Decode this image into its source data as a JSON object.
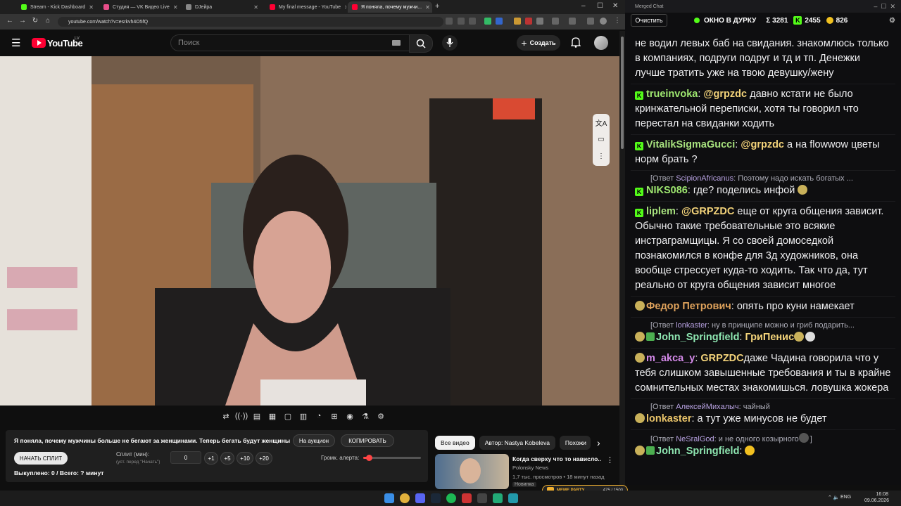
{
  "browser": {
    "tabs": [
      {
        "title": "Stream - Kick Dashboard",
        "color": "#53fc18"
      },
      {
        "title": "Студия — VK Видео Live",
        "color": "#e84e8a"
      },
      {
        "title": "DJейра",
        "color": "#888888"
      },
      {
        "title": "My final message - YouTube",
        "color": "#ff0033"
      },
      {
        "title": "Я поняла, почему мужчи...",
        "color": "#ff0033"
      }
    ],
    "url": "youtube.com/watch?v=esrkvh4O5fQ"
  },
  "youtube": {
    "brand": "YouTube",
    "region": "LV",
    "search_placeholder": "Поиск",
    "create_label": "Создать"
  },
  "panel": {
    "title": "Я поняла, почему мужчины больше не бегают за женщинами. Теперь бегать будут женщины",
    "auction_label": "На аукцион",
    "copy_label": "КОПИРОВАТЬ",
    "start_split_label": "НАЧАТЬ СПЛИТ",
    "split_label": "Сплит (мин):",
    "split_hint": "(уст. перед \"Начать\")",
    "split_value": "0",
    "plus_buttons": [
      "+1",
      "+5",
      "+10",
      "+20"
    ],
    "volume_label": "Громк. алерта:",
    "volume_level": 0.1,
    "bought_label": "Выкуплено: 0 / Всего: ? минут"
  },
  "recommend": {
    "chips": [
      "Все видео",
      "Автор: Nastya Kobeleva",
      "Похожи"
    ],
    "video": {
      "title": "Когда сверху что то нависло...",
      "channel": "Polonsky News",
      "meta": "1,7 тыс. просмотров • 18 минут назад",
      "badge": "Новинка"
    }
  },
  "chat": {
    "window_title": "Merged Chat",
    "clear_label": "Очистить",
    "top_label": "ОКНО В ДУРКУ",
    "sigma": "Σ 3281",
    "kick_count": "2455",
    "third_count": "826",
    "messages": [
      {
        "text": "не водил левых баб на свидания. знакомлюсь только в компаниях, подруги подруг и тд и тп. Денежки лучше тратить уже на твою девушку/жену"
      },
      {
        "user": "trueinvoka",
        "mention": "@grpzdc",
        "text": "давно кстати не было кринжательной переписки, хотя ты говорил что перестал на свиданки ходить"
      },
      {
        "user": "VitalikSigmaGucci",
        "mention": "@grpzdc",
        "text": "а на flowwow цветы норм брать ?"
      },
      {
        "reply_user": "ScipionAfricanus",
        "reply_text": "Поэтому надо искать богатых ...",
        "user": "NIKS086",
        "text": "где? поделись инфой"
      },
      {
        "user": "liplem",
        "mention": "@GRPZDC",
        "text": "еще от круга общения зависит. Обычно такие требовательные это всякие инстраграмщицы. Я со своей домоседкой познакомился в конфе для 3д художников, она вообще стрессует куда-то ходить. Так что да, тут реально от круга общения зависит многое"
      },
      {
        "user": "Федор Петрович",
        "text": "опять про куни намекает"
      },
      {
        "reply_user": "lonkaster",
        "reply_text": "ну в принципе можно и гриб подарить...",
        "user": "John_Springfield",
        "text": "ГриПенис"
      },
      {
        "user": "m_akca_y",
        "mention": "GRPZDC",
        "text": "даже Чадина говорила что у тебя слишком завышенные требования и ты в крайне сомнительных местах знакомишься. ловушка жокера"
      },
      {
        "reply_user": "АлексейМихалыч",
        "reply_text": "чайный",
        "user": "lonkaster",
        "text": "а тут уже минусов не будет"
      },
      {
        "reply_user": "NeSralGod",
        "reply_text": "и не одного козырного",
        "user": "John_Springfield",
        "text": ""
      }
    ],
    "reply_prefix": "[Ответ",
    "reply_suffix": "]"
  },
  "overlay": {
    "label": "MEME PARTY",
    "progress": "475 / 1500"
  },
  "taskbar": {
    "lang": "ENG",
    "time": "16:08",
    "date": "09.06.2026"
  }
}
